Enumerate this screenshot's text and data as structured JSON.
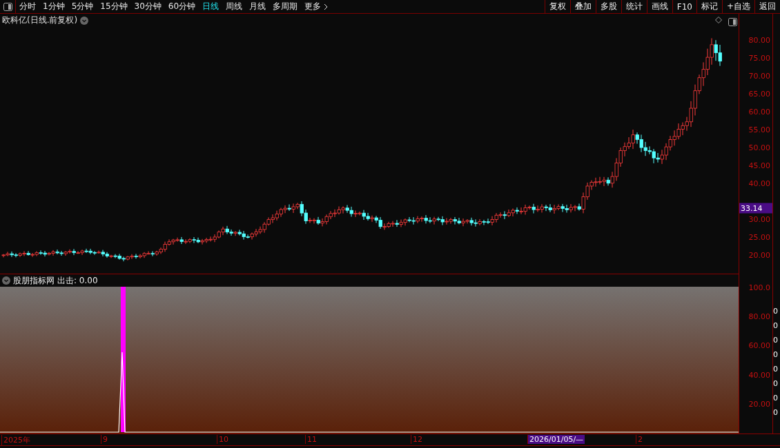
{
  "toolbar": {
    "periods": [
      {
        "label": "分时",
        "selected": false
      },
      {
        "label": "1分钟",
        "selected": false
      },
      {
        "label": "5分钟",
        "selected": false
      },
      {
        "label": "15分钟",
        "selected": false
      },
      {
        "label": "30分钟",
        "selected": false
      },
      {
        "label": "60分钟",
        "selected": false
      },
      {
        "label": "日线",
        "selected": true
      },
      {
        "label": "周线",
        "selected": false
      },
      {
        "label": "月线",
        "selected": false
      },
      {
        "label": "多周期",
        "selected": false
      }
    ],
    "more": "更多",
    "actions": [
      "复权",
      "叠加",
      "多股",
      "统计",
      "画线",
      "F10",
      "标记",
      "+自选",
      "返回"
    ]
  },
  "main_chart": {
    "title": "欧科亿(日线.前复权)",
    "price_axis": [
      "80.00",
      "75.00",
      "70.00",
      "65.00",
      "60.00",
      "55.00",
      "50.00",
      "45.00",
      "40.00",
      "30.00",
      "25.00",
      "20.00"
    ],
    "last_price": "33.14"
  },
  "indicator": {
    "name": "股朋指标网",
    "reading": "出击: 0.00",
    "axis": [
      "100.0",
      "80.00",
      "60.00",
      "40.00",
      "20.00"
    ],
    "side_values": [
      "0",
      "0",
      "0",
      "0",
      "0",
      "0",
      "0",
      "0"
    ]
  },
  "time_axis": [
    {
      "label": "2025年",
      "selected": false
    },
    {
      "label": "9",
      "selected": false
    },
    {
      "label": "10",
      "selected": false
    },
    {
      "label": "11",
      "selected": false
    },
    {
      "label": "12",
      "selected": false
    },
    {
      "label": "2026/01/05/—",
      "selected": true
    },
    {
      "label": "2",
      "selected": false
    }
  ]
}
